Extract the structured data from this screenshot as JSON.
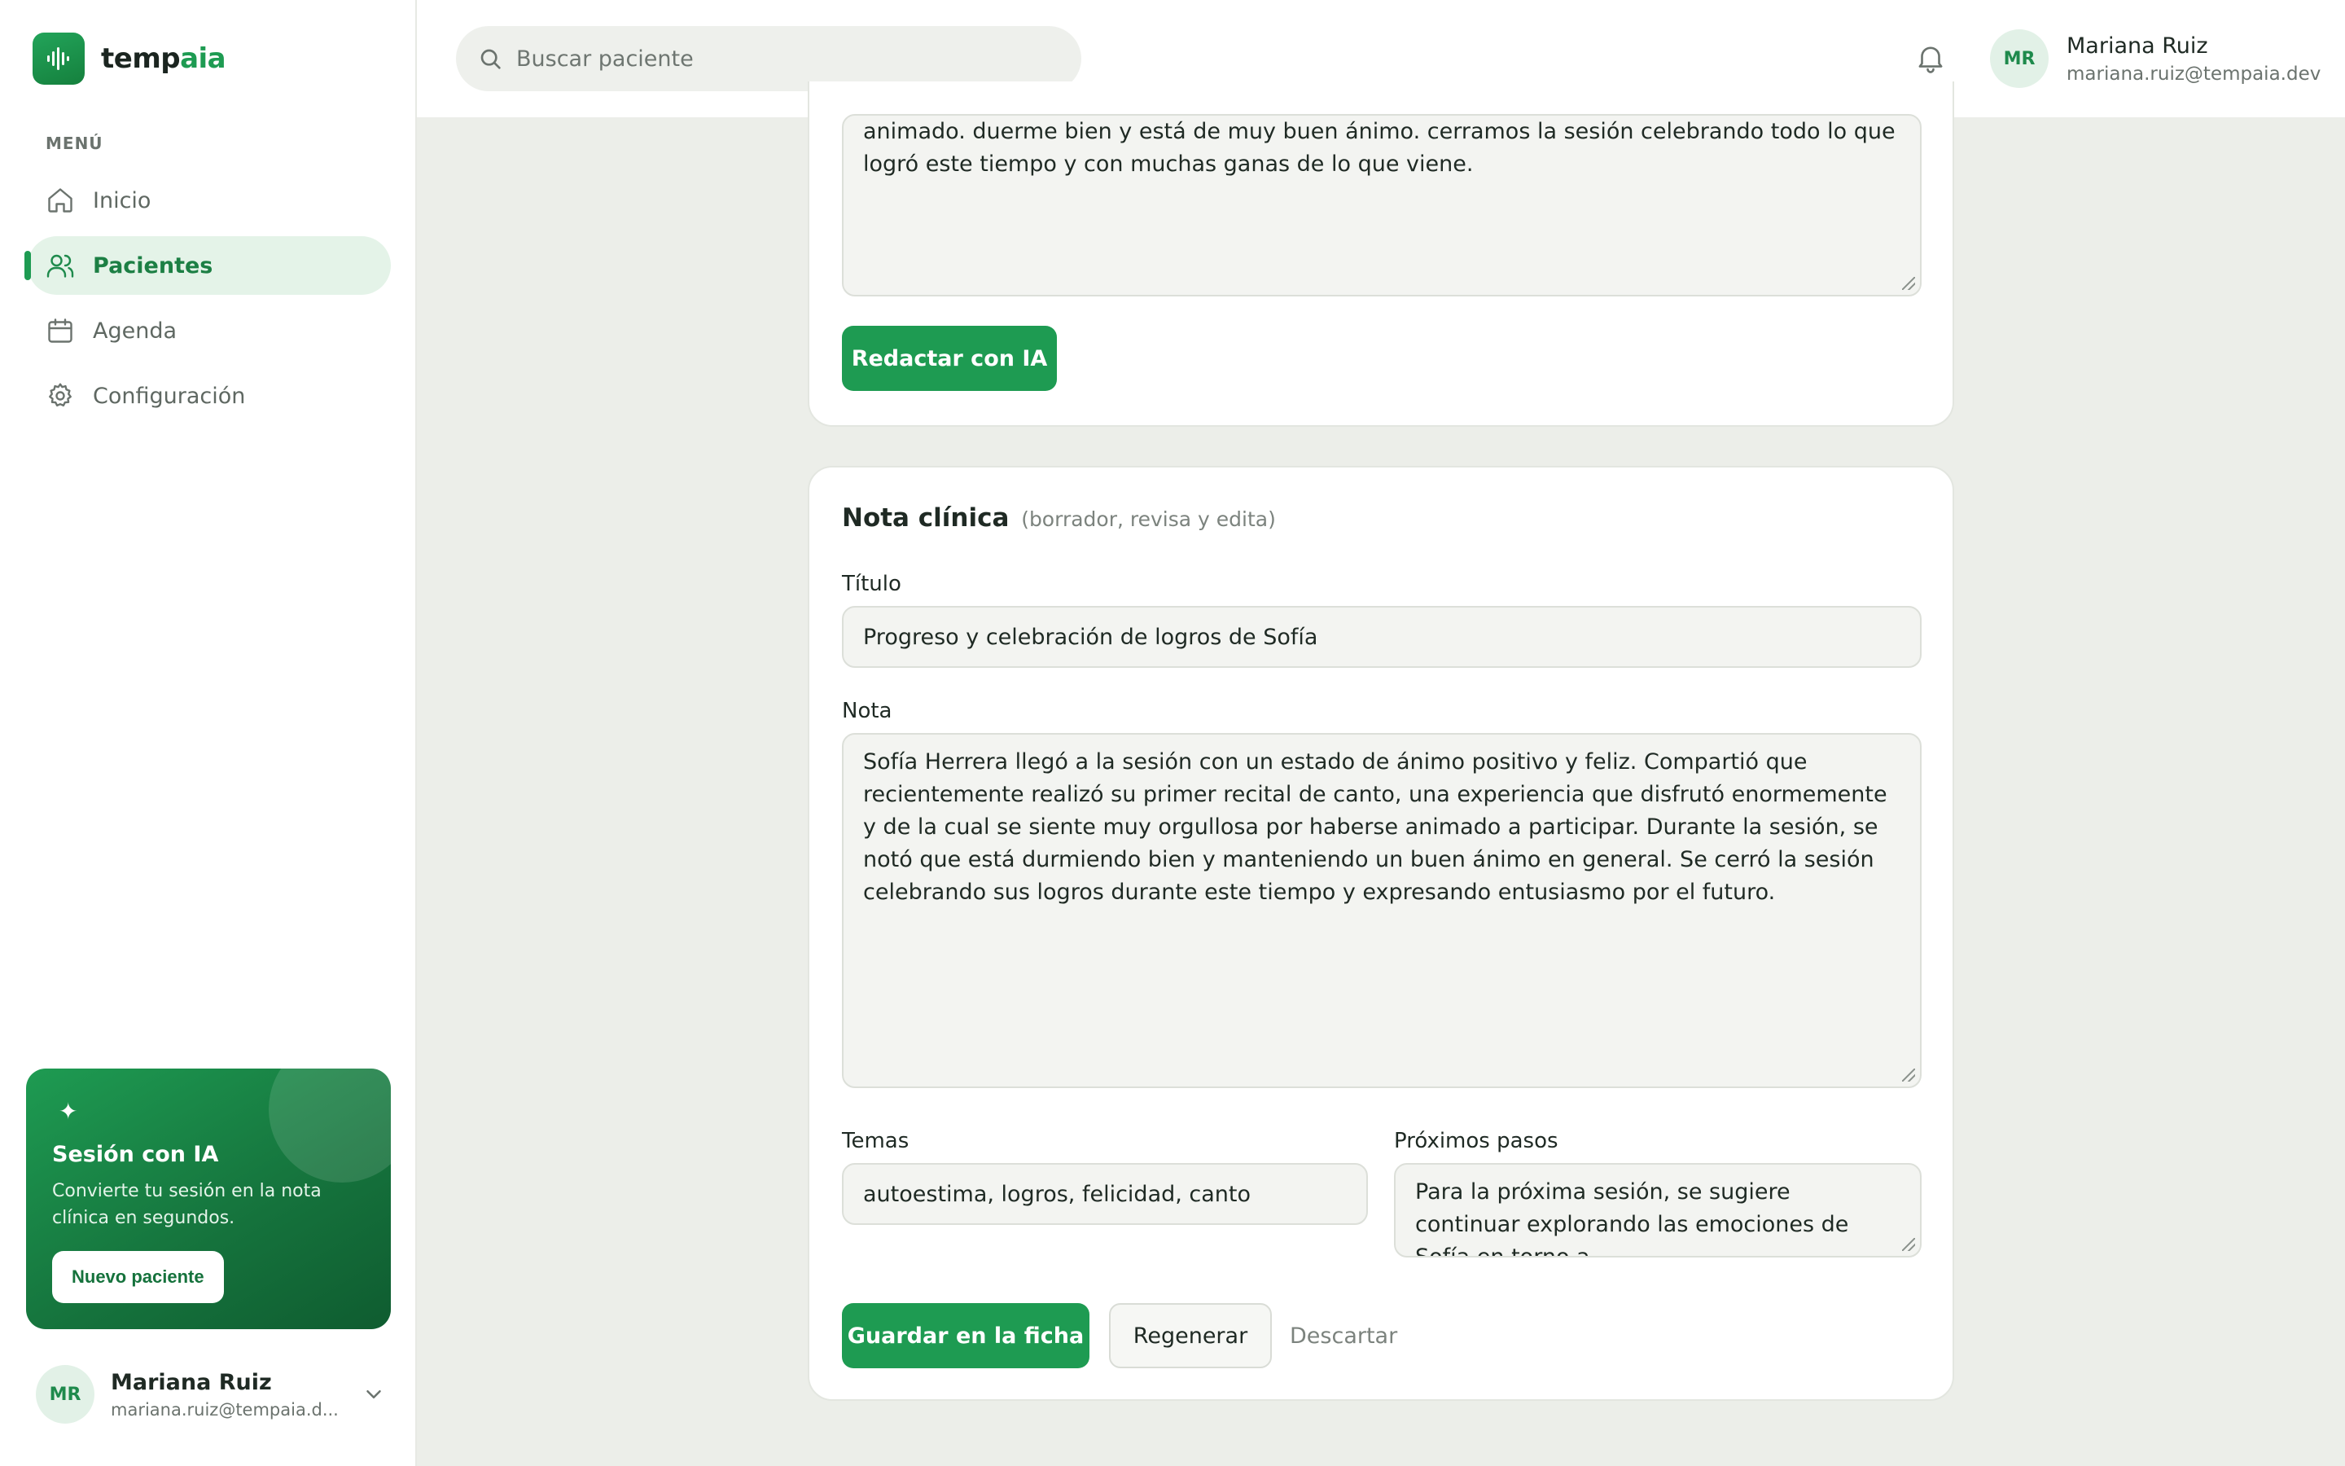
{
  "brand": {
    "name_main": "temp",
    "name_accent": "aia"
  },
  "sidebar": {
    "menu_label": "MENÚ",
    "items": [
      {
        "label": "Inicio",
        "icon": "home-icon",
        "active": false
      },
      {
        "label": "Pacientes",
        "icon": "users-icon",
        "active": true
      },
      {
        "label": "Agenda",
        "icon": "calendar-icon",
        "active": false
      },
      {
        "label": "Configuración",
        "icon": "gear-icon",
        "active": false
      }
    ],
    "promo": {
      "title": "Sesión con IA",
      "description": "Convierte tu sesión en la nota clínica en segundos.",
      "button": "Nuevo paciente"
    },
    "user": {
      "initials": "MR",
      "name": "Mariana Ruiz",
      "email": "mariana.ruiz@tempaia.d..."
    }
  },
  "topbar": {
    "search_placeholder": "Buscar paciente",
    "user": {
      "initials": "MR",
      "name": "Mariana Ruiz",
      "email": "mariana.ruiz@tempaia.dev"
    }
  },
  "transcript": {
    "text": "animado. duerme bien y está de muy buen ánimo. cerramos la sesión celebrando todo lo que logró este tiempo y con muchas ganas de lo que viene.",
    "button": "Redactar con IA"
  },
  "note": {
    "title": "Nota clínica",
    "subtitle": "(borrador, revisa y edita)",
    "title_label": "Título",
    "title_value": "Progreso y celebración de logros de Sofía",
    "note_label": "Nota",
    "note_value": "Sofía Herrera llegó a la sesión con un estado de ánimo positivo y feliz. Compartió que recientemente realizó su primer recital de canto, una experiencia que disfrutó enormemente y de la cual se siente muy orgullosa por haberse animado a participar. Durante la sesión, se notó que está durmiendo bien y manteniendo un buen ánimo en general. Se cerró la sesión celebrando sus logros durante este tiempo y expresando entusiasmo por el futuro.",
    "topics_label": "Temas",
    "topics_value": "autoestima, logros, felicidad, canto",
    "next_label": "Próximos pasos",
    "next_value": "Para la próxima sesión, se sugiere continuar explorando las emociones de Sofía en torno a",
    "save_button": "Guardar en la ficha",
    "regen_button": "Regenerar",
    "discard_button": "Descartar"
  },
  "colors": {
    "accent": "#1e9b52",
    "accent_dark": "#15723c",
    "background": "#eceee9"
  }
}
